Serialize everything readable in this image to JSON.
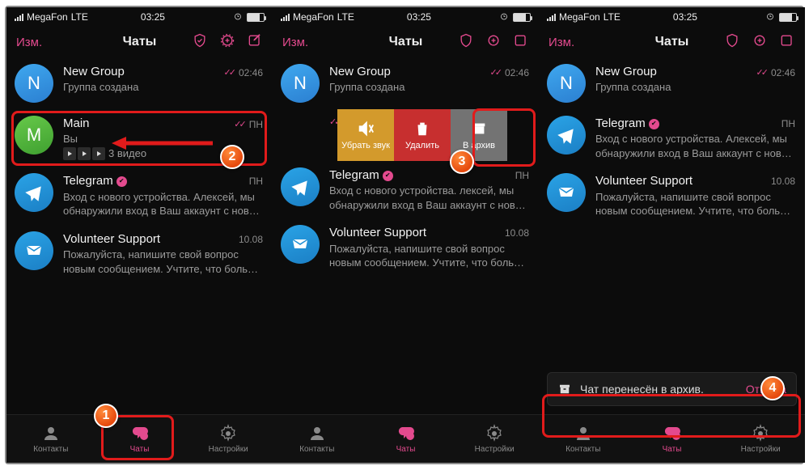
{
  "status": {
    "carrier": "MegaFon",
    "net": "LTE",
    "time": "03:25"
  },
  "header": {
    "edit": "Изм.",
    "title": "Чаты"
  },
  "chats": {
    "newgroup": {
      "name": "New Group",
      "msg": "Группа создана",
      "time": "02:46",
      "initial": "N"
    },
    "main": {
      "name": "Main",
      "you": "Вы",
      "videos": "3 видео",
      "time": "ПН",
      "initial": "M"
    },
    "telegram": {
      "name": "Telegram",
      "msg": "Вход с нового устройства. Алексей, мы обнаружили вход в Ваш аккаунт с нов…",
      "time": "ПН"
    },
    "telegram_short": {
      "msg": "Вход с нового устройства.   лексей, мы обнаружили вход в Ваш аккаунт с нов…"
    },
    "vs": {
      "name": "Volunteer Support",
      "msg": "Пожалуйста, напишите свой вопрос новым сообщением. Учтите, что боль…",
      "time": "10.08"
    }
  },
  "swipe": {
    "mute": "Убрать звук",
    "delete": "Удалить",
    "archive": "В архив"
  },
  "snackbar": {
    "text": "Чат перенесён в архив.",
    "cancel": "Отмена"
  },
  "tabs": {
    "contacts": "Контакты",
    "chats": "Чаты",
    "settings": "Настройки"
  }
}
